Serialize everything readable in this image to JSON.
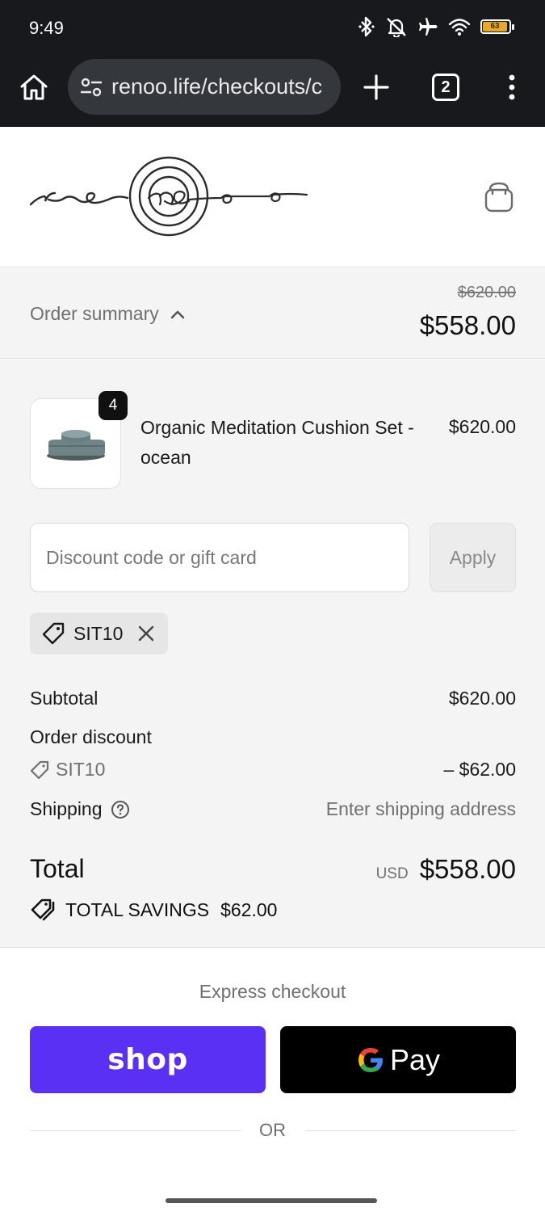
{
  "status_bar": {
    "time": "9:49",
    "battery": "63",
    "icons": [
      "bluetooth-icon",
      "silent-bell-icon",
      "airplane-icon",
      "wifi-icon",
      "battery-icon"
    ]
  },
  "browser": {
    "url": "renoo.life/checkouts/c",
    "tab_count": "2",
    "icons": [
      "home-icon",
      "site-settings-icon",
      "plus-icon",
      "tabs-icon",
      "more-vert-icon"
    ]
  },
  "store": {
    "brand": "renoo",
    "cart_icon": "shopping-bag-icon"
  },
  "summary": {
    "label": "Order summary",
    "original_price": "$620.00",
    "total": "$558.00"
  },
  "line_items": [
    {
      "quantity": "4",
      "name": "Organic Meditation Cushion Set - ocean",
      "price": "$620.00"
    }
  ],
  "discount": {
    "placeholder": "Discount code or gift card",
    "value": "",
    "apply_label": "Apply",
    "applied_code": "SIT10"
  },
  "totals": {
    "subtotal_label": "Subtotal",
    "subtotal_value": "$620.00",
    "order_discount_label": "Order discount",
    "discount_code": "SIT10",
    "discount_value": "– $62.00",
    "shipping_label": "Shipping",
    "shipping_value": "Enter shipping address",
    "total_label": "Total",
    "currency": "USD",
    "total_value": "$558.00",
    "savings_label": "TOTAL SAVINGS",
    "savings_value": "$62.00"
  },
  "express": {
    "title": "Express checkout",
    "shop_label": "shop",
    "gpay_label": "Pay",
    "or_label": "OR"
  },
  "colors": {
    "shop_purple": "#5a31f4",
    "chrome_bg": "#17191c",
    "panel_bg": "#f4f4f4"
  }
}
